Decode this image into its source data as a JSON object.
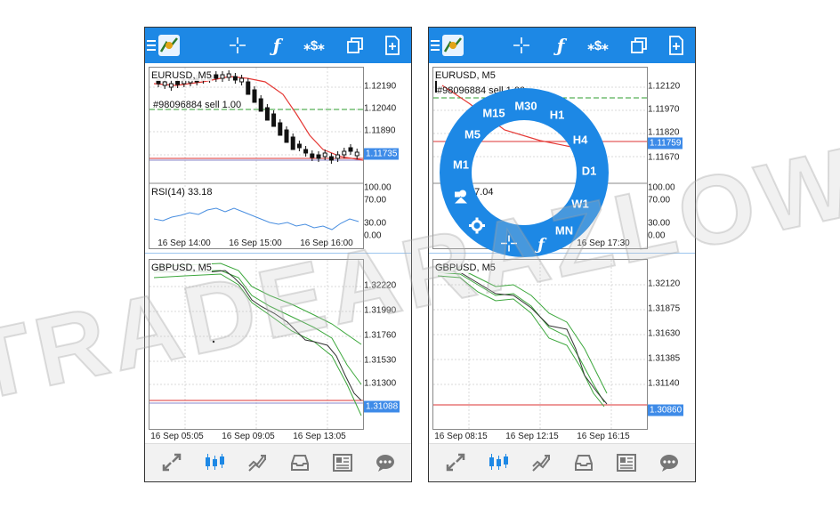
{
  "brand_color": "#1d88e5",
  "left": {
    "topbar_icons": [
      "menu-icon",
      "metatrader-logo-icon",
      "crosshair-icon",
      "indicators-icon",
      "objects-icon",
      "windows-icon",
      "add-chart-icon"
    ],
    "chart1": {
      "title": "EURUSD, M5",
      "order_label": "#98096884 sell 1.00",
      "price_ticks": [
        "1.12190",
        "1.12040",
        "1.11890",
        "1.11735"
      ],
      "current_price": "1.11735",
      "rsi_title": "RSI(14) 33.18",
      "rsi_ticks": [
        "100.00",
        "70.00",
        "30.00",
        "0.00"
      ],
      "time_ticks": [
        "16 Sep 14:00",
        "16 Sep 15:00",
        "16 Sep 16:00"
      ]
    },
    "chart2": {
      "title": "GBPUSD, M5",
      "price_ticks": [
        "1.32220",
        "1.31990",
        "1.31760",
        "1.31530",
        "1.31300"
      ],
      "current_price": "1.31088",
      "time_ticks": [
        "16 Sep 05:05",
        "16 Sep 09:05",
        "16 Sep 13:05"
      ]
    }
  },
  "right": {
    "chart1": {
      "title": "EURUSD, M5",
      "order_label": "#98096884 sell 1.00",
      "price_ticks": [
        "1.12120",
        "1.11970",
        "1.11820",
        "1.11670"
      ],
      "current_price": "1.11759",
      "rsi_value": "47.04",
      "rsi_ticks": [
        "100.00",
        "70.00",
        "30.00",
        "0.00"
      ],
      "time_ticks": [
        "16 Sep 17:30"
      ]
    },
    "chart2": {
      "title": "GBPUSD, M5",
      "price_ticks": [
        "1.32120",
        "1.31875",
        "1.31630",
        "1.31385",
        "1.31140"
      ],
      "current_price": "1.30860",
      "time_ticks": [
        "16 Sep 08:15",
        "16 Sep 12:15",
        "16 Sep 16:15"
      ]
    },
    "timeframe_wheel": {
      "items": [
        "M1",
        "M5",
        "M15",
        "M30",
        "H1",
        "H4",
        "D1",
        "W1",
        "MN"
      ],
      "tools": [
        "settings-icon",
        "crosshair-icon",
        "indicators-icon",
        "objects-icon"
      ]
    }
  },
  "bottom_nav": [
    "quotes-icon",
    "chart-icon",
    "trade-icon",
    "history-icon",
    "news-icon",
    "messages-icon"
  ],
  "watermark": "TRADEARAZLOW"
}
